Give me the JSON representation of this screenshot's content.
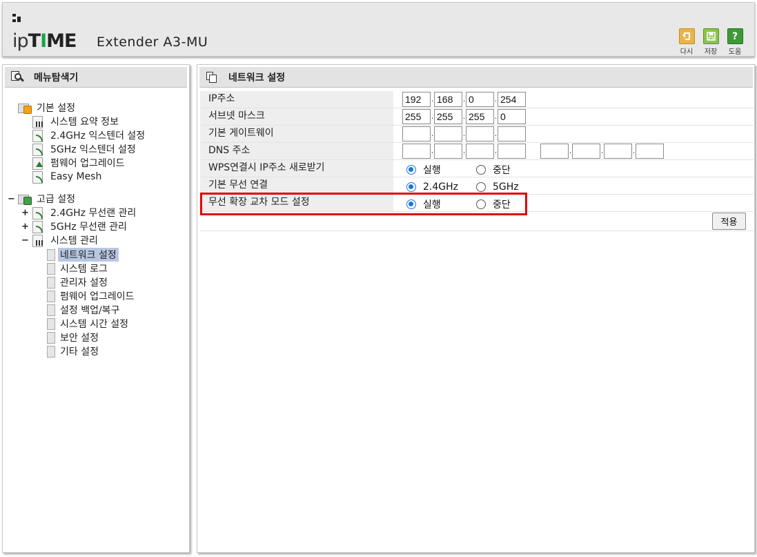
{
  "header": {
    "logo_ip": "ip",
    "logo_t": "T",
    "logo_i": "I",
    "logo_me": "ME",
    "model": "Extender A3-MU",
    "buttons": [
      {
        "label": "다시",
        "icon": "undo-icon"
      },
      {
        "label": "저장",
        "icon": "save-icon"
      },
      {
        "label": "도움",
        "icon": "help-icon",
        "glyph": "?"
      }
    ]
  },
  "sidebar": {
    "title": "메뉴탐색기",
    "basic": {
      "label": "기본 설정",
      "items": [
        "시스템 요약 정보",
        "2.4GHz 익스텐더 설정",
        "5GHz 익스텐더 설정",
        "펌웨어 업그레이드",
        "Easy Mesh"
      ]
    },
    "advanced": {
      "expander": "−",
      "label": "고급 설정",
      "wlan24": {
        "expander": "+",
        "label": "2.4GHz 무선랜 관리"
      },
      "wlan5": {
        "expander": "+",
        "label": "5GHz 무선랜 관리"
      },
      "system": {
        "expander": "−",
        "label": "시스템 관리",
        "items": [
          "네트워크 설정",
          "시스템 로그",
          "관리자 설정",
          "펌웨어 업그레이드",
          "설정 백업/복구",
          "시스템 시간 설정",
          "보안 설정",
          "기타 설정"
        ]
      }
    }
  },
  "main": {
    "title": "네트워크 설정",
    "ip": {
      "label": "IP주소",
      "octets": [
        "192",
        "168",
        "0",
        "254"
      ]
    },
    "subnet": {
      "label": "서브넷 마스크",
      "octets": [
        "255",
        "255",
        "255",
        "0"
      ]
    },
    "gateway": {
      "label": "기본 게이트웨이",
      "octets": [
        "",
        "",
        "",
        ""
      ]
    },
    "dns": {
      "label": "DNS 주소",
      "primary": [
        "",
        "",
        "",
        ""
      ],
      "secondary": [
        "",
        "",
        "",
        ""
      ]
    },
    "wps": {
      "label": "WPS연결시 IP주소 새로받기",
      "options": [
        "실행",
        "중단"
      ],
      "selected": "실행"
    },
    "wireless": {
      "label": "기본 무선 연결",
      "options": [
        "2.4GHz",
        "5GHz"
      ],
      "selected": "2.4GHz"
    },
    "crossband": {
      "label": "무선 확장 교차 모드 설정",
      "options": [
        "실행",
        "중단"
      ],
      "selected": "실행"
    },
    "apply_label": "적용",
    "colors": {
      "highlight": "#e00000",
      "radio_on": "#1a73e8",
      "selected_item": "#b7c7e2"
    }
  }
}
